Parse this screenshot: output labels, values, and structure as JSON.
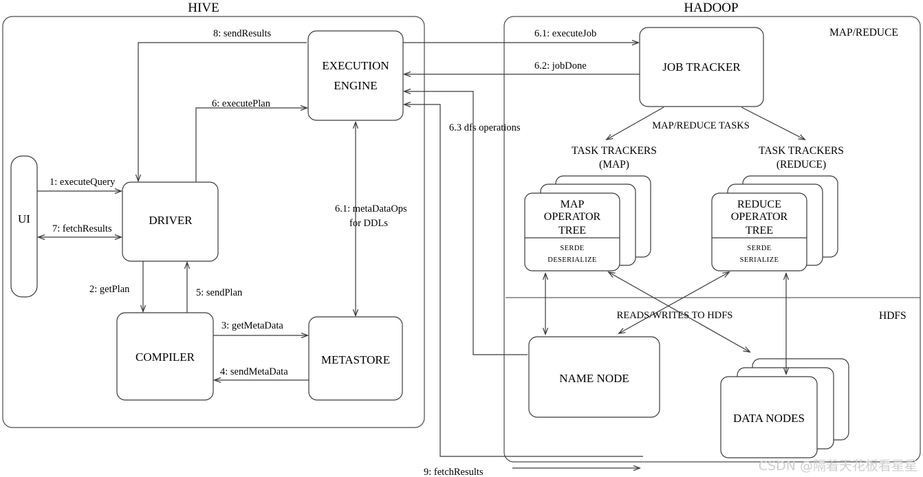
{
  "diagram": {
    "title_hive": "HIVE",
    "title_hadoop": "HADOOP",
    "corner_mapreduce": "MAP/REDUCE",
    "corner_hdfs": "HDFS",
    "watermark": "CSDN @隔着天花板看星星",
    "stroke_color": "#3a3a3a",
    "box_fill": "#ffffff",
    "watermark_color": "#cfcfcf"
  },
  "nodes": {
    "ui": "UI",
    "driver": "DRIVER",
    "compiler": "COMPILER",
    "metastore": "METASTORE",
    "execution_engine_l1": "EXECUTION",
    "execution_engine_l2": "ENGINE",
    "job_tracker": "JOB TRACKER",
    "task_trackers_map_l1": "TASK TRACKERS",
    "task_trackers_map_l2": "(MAP)",
    "task_trackers_reduce_l1": "TASK TRACKERS",
    "task_trackers_reduce_l2": "(REDUCE)",
    "map_operator_l1": "MAP",
    "map_operator_l2": "OPERATOR",
    "map_operator_l3": "TREE",
    "map_serde_l1": "SERDE",
    "map_serde_l2": "DESERIALIZE",
    "reduce_operator_l1": "REDUCE",
    "reduce_operator_l2": "OPERATOR",
    "reduce_operator_l3": "TREE",
    "reduce_serde_l1": "SERDE",
    "reduce_serde_l2": "SERIALIZE",
    "name_node": "NAME NODE",
    "data_nodes": "DATA NODES"
  },
  "edges": {
    "e1_execute_query": "1: executeQuery",
    "e2_get_plan": "2: getPlan",
    "e3_get_metadata": "3: getMetaData",
    "e4_send_metadata": "4: sendMetaData",
    "e5_send_plan": "5: sendPlan",
    "e6_execute_plan": "6: executePlan",
    "e61_metadataops_l1": "6.1: metaDataOps",
    "e61_metadataops_l2": "for DDLs",
    "e7_fetch_results": "7: fetchResults",
    "e8_send_results": "8: sendResults",
    "e61_execute_job": "6.1: executeJob",
    "e62_job_done": "6.2: jobDone",
    "e63_dfs_operations": "6.3 dfs operations",
    "e9_fetch_results": "9: fetchResults",
    "map_reduce_tasks": "MAP/REDUCE TASKS",
    "reads_writes_hdfs": "READS/WRITES TO HDFS"
  }
}
